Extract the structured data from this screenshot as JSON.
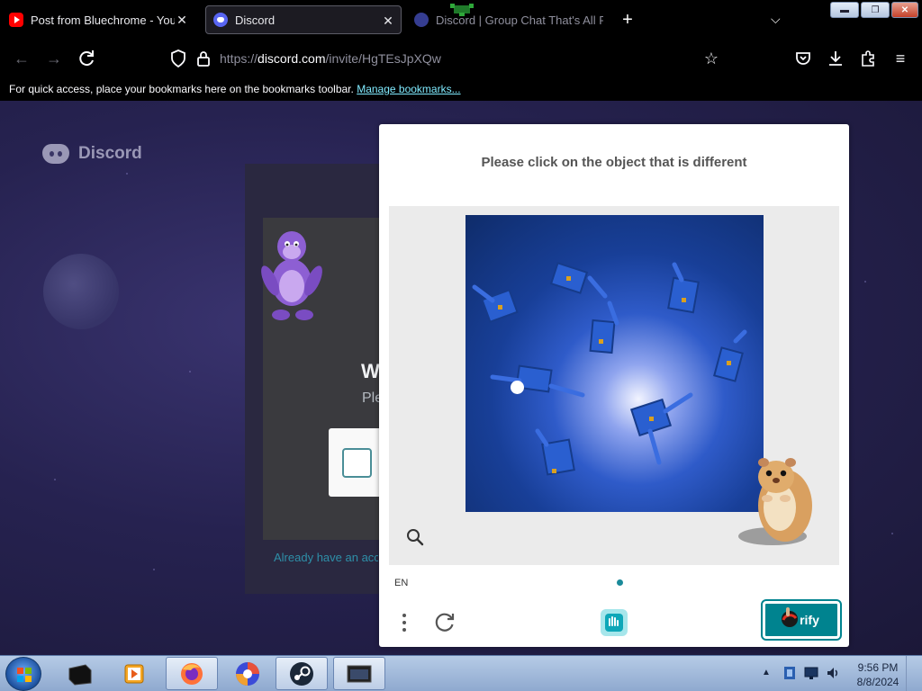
{
  "browser": {
    "tabs": [
      {
        "title": "Post from Bluechrome - YouTube",
        "close": "✕"
      },
      {
        "title": "Discord",
        "close": "✕"
      },
      {
        "title": "Discord | Group Chat That's All Fun & Games",
        "close": "✕"
      }
    ],
    "new_tab": "+",
    "tab_list": "⌵",
    "url_prefix": "https://",
    "url_host": "discord.com",
    "url_path": "/invite/HgTEsJpXQw",
    "bookmarks_text": "For quick access, place your bookmarks here on the bookmarks toolbar.",
    "bookmarks_link": "Manage bookmarks...",
    "window_controls": {
      "minimize": "▬",
      "restore": "❐",
      "close": "✕"
    }
  },
  "page": {
    "brand": "Discord",
    "invite_heading": "W",
    "invite_sub": "Ple",
    "already_text": "Already have an account?"
  },
  "captcha": {
    "prompt": "Please click on the object that is different",
    "language": "EN",
    "verify_label": "rify",
    "accent": "#00838f"
  },
  "taskbar": {
    "time": "9:56 PM",
    "date": "8/8/2024",
    "tray_arrow": "▲"
  }
}
